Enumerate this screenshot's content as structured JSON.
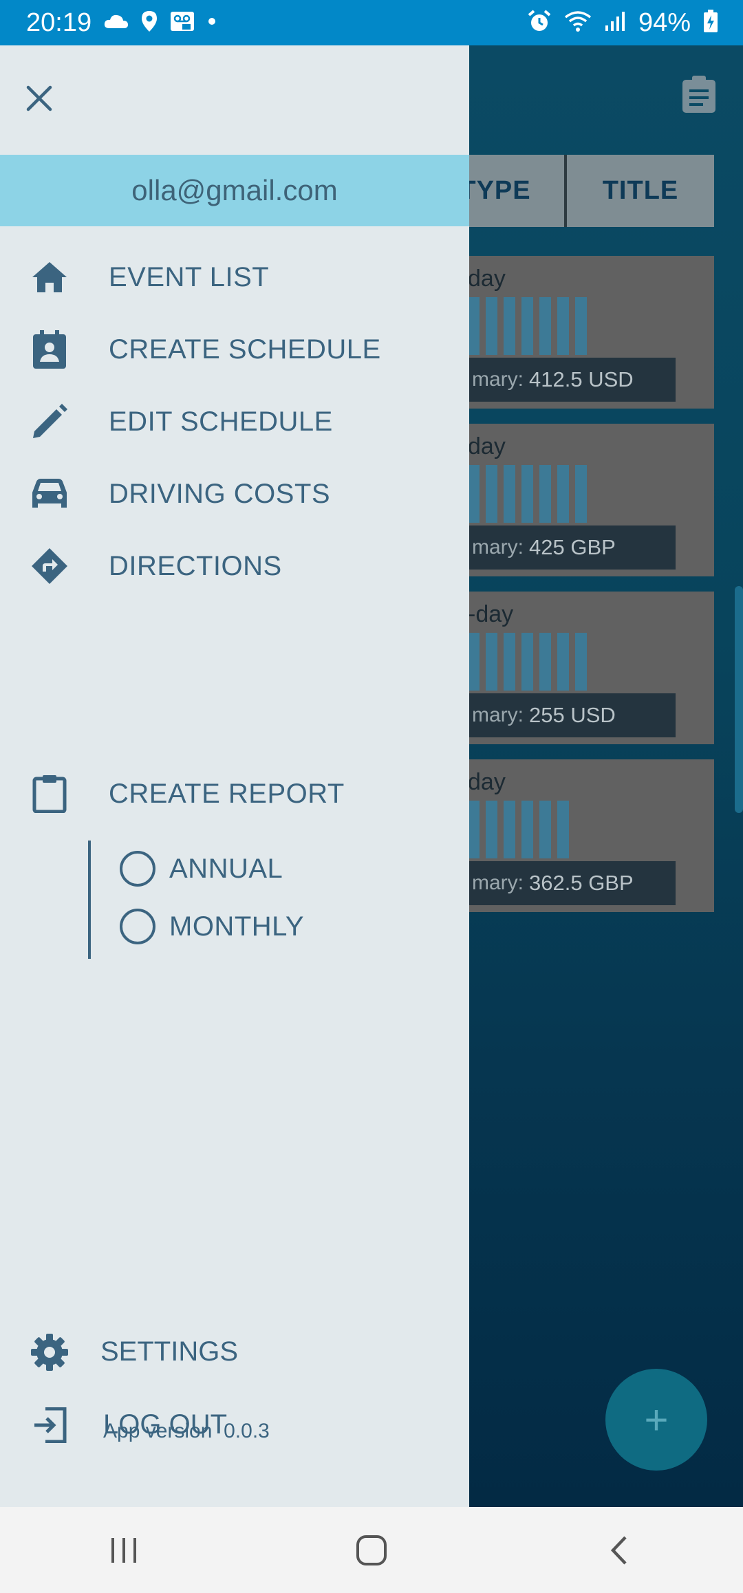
{
  "status_bar": {
    "time": "20:19",
    "battery": "94%",
    "icons_left": [
      "cloud-icon",
      "location-icon",
      "voicemail-icon",
      "dot-icon"
    ],
    "icons_right": [
      "alarm-icon",
      "wifi-icon",
      "signal-icon",
      "battery-charging-icon"
    ]
  },
  "background": {
    "header_cells": [
      "TYPE",
      "TITLE"
    ],
    "cards": [
      {
        "title": "day",
        "bars": 7,
        "summary_prefix": "mary:",
        "summary_value": "412.5 USD"
      },
      {
        "title": "day",
        "bars": 7,
        "summary_prefix": "mary:",
        "summary_value": "425 GBP"
      },
      {
        "title": "-day",
        "bars": 7,
        "summary_prefix": "mary:",
        "summary_value": "255 USD"
      },
      {
        "title": "day",
        "bars": 6,
        "summary_prefix": "mary:",
        "summary_value": "362.5 GBP"
      }
    ],
    "fab_label": "+"
  },
  "drawer": {
    "email": "olla@gmail.com",
    "menu": [
      {
        "label": "EVENT LIST",
        "icon": "home-icon"
      },
      {
        "label": "CREATE SCHEDULE",
        "icon": "contact-badge-icon"
      },
      {
        "label": "EDIT SCHEDULE",
        "icon": "pencil-icon"
      },
      {
        "label": "DRIVING COSTS",
        "icon": "car-icon"
      },
      {
        "label": "DIRECTIONS",
        "icon": "directions-icon"
      }
    ],
    "report": {
      "label": "CREATE REPORT",
      "icon": "clipboard-icon",
      "options": [
        {
          "label": "ANNUAL",
          "selected": false
        },
        {
          "label": "MONTHLY",
          "selected": false
        }
      ]
    },
    "settings_label": "SETTINGS",
    "logout_label": "LOG OUT",
    "version_label": "App version",
    "version_value": "0.0.3"
  },
  "colors": {
    "status_bar": "#0288c8",
    "drawer_bg": "#e2e9ec",
    "email_band": "#8dd3e6",
    "accent_text": "#3b6480"
  }
}
